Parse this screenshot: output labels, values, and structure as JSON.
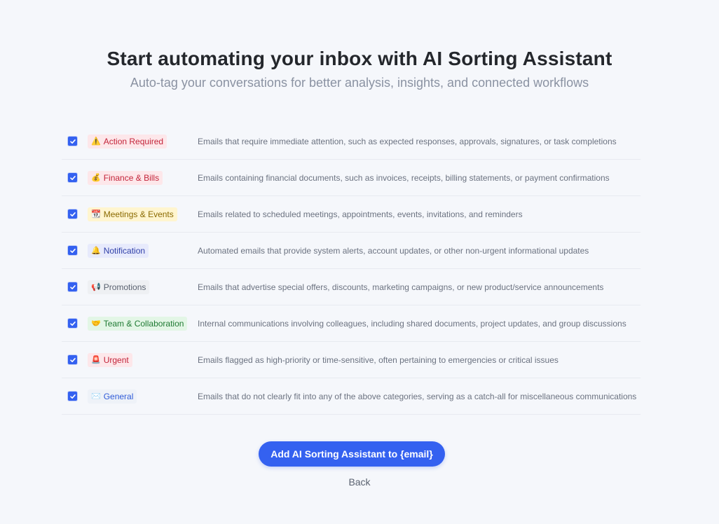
{
  "header": {
    "title": "Start automating your inbox with AI Sorting Assistant",
    "subtitle": "Auto-tag your conversations for better analysis, insights, and connected workflows"
  },
  "categories": [
    {
      "checked": true,
      "icon": "warning-icon",
      "emoji": "⚠️",
      "label": "Action Required",
      "tag_bg": "#fde7ea",
      "tag_color": "#c3243a",
      "description": "Emails that require immediate attention, such as expected responses, approvals, signatures, or task completions"
    },
    {
      "checked": true,
      "icon": "money-bag-icon",
      "emoji": "💰",
      "label": "Finance & Bills",
      "tag_bg": "#fde7ea",
      "tag_color": "#c3243a",
      "description": "Emails containing financial documents, such as invoices, receipts, billing statements, or payment confirmations"
    },
    {
      "checked": true,
      "icon": "calendar-icon",
      "emoji": "📆",
      "label": "Meetings & Events",
      "tag_bg": "#fff5cf",
      "tag_color": "#8a6a00",
      "description": "Emails related to scheduled meetings, appointments, events, invitations, and reminders"
    },
    {
      "checked": true,
      "icon": "bell-icon",
      "emoji": "🔔",
      "label": "Notification",
      "tag_bg": "#e7eafc",
      "tag_color": "#2f3fa8",
      "description": "Automated emails that provide system alerts, account updates, or other non-urgent informational updates"
    },
    {
      "checked": true,
      "icon": "megaphone-icon",
      "emoji": "📢",
      "label": "Promotions",
      "tag_bg": "#eef0f3",
      "tag_color": "#5a6270",
      "description": "Emails that advertise special offers, discounts, marketing campaigns, or new product/service announcements"
    },
    {
      "checked": true,
      "icon": "handshake-icon",
      "emoji": "🤝",
      "label": "Team & Collaboration",
      "tag_bg": "#e3f6e6",
      "tag_color": "#1f7a33",
      "description": "Internal communications involving colleagues, including shared documents, project updates, and group discussions"
    },
    {
      "checked": true,
      "icon": "siren-icon",
      "emoji": "🚨",
      "label": "Urgent",
      "tag_bg": "#fde7ea",
      "tag_color": "#c3243a",
      "description": "Emails flagged as high-priority or time-sensitive, often pertaining to emergencies or critical issues"
    },
    {
      "checked": true,
      "icon": "envelope-icon",
      "emoji": "✉️",
      "label": "General",
      "tag_bg": "#eef2f8",
      "tag_color": "#2f5bd8",
      "description": "Emails that do not clearly fit into any of the above categories, serving as a catch-all for miscellaneous communications"
    }
  ],
  "actions": {
    "primary_label": "Add AI Sorting Assistant to {email}",
    "back_label": "Back"
  },
  "colors": {
    "accent": "#3461f0",
    "background": "#f5f7fb"
  }
}
